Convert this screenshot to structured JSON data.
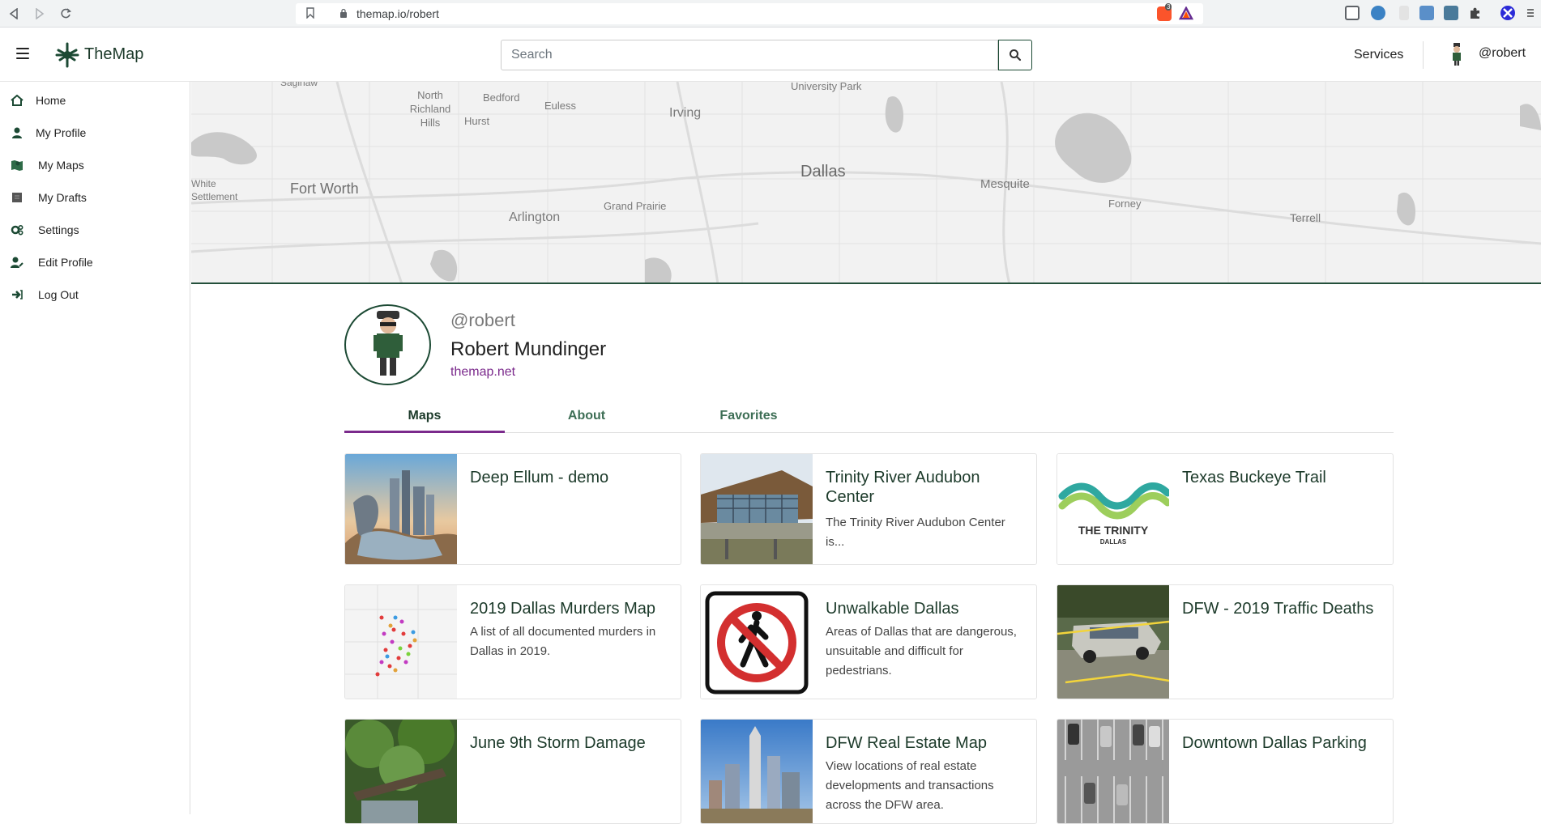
{
  "browser": {
    "url": "themap.io/robert",
    "brave_badge": "3"
  },
  "header": {
    "logo_text": "TheMap",
    "search_placeholder": "Search",
    "services_label": "Services",
    "username": "@robert"
  },
  "sidebar": {
    "items": [
      {
        "label": "Home",
        "icon": "home-icon"
      },
      {
        "label": "My Profile",
        "icon": "user-icon"
      },
      {
        "label": "My Maps",
        "icon": "map-icon"
      },
      {
        "label": "My Drafts",
        "icon": "drafts-icon"
      },
      {
        "label": "Settings",
        "icon": "gears-icon"
      },
      {
        "label": "Edit Profile",
        "icon": "user-edit-icon"
      },
      {
        "label": "Log Out",
        "icon": "logout-icon"
      }
    ]
  },
  "map_banner": {
    "labels": [
      "Saginaw",
      "North Richland Hills",
      "Bedford",
      "Euless",
      "Hurst",
      "Irving",
      "University Park",
      "Dallas",
      "Fort Worth",
      "White Settlement",
      "Arlington",
      "Grand Prairie",
      "Mesquite",
      "Forney",
      "Terrell"
    ]
  },
  "profile": {
    "handle": "@robert",
    "name": "Robert Mundinger",
    "website": "themap.net"
  },
  "tabs": [
    {
      "label": "Maps",
      "active": true
    },
    {
      "label": "About",
      "active": false
    },
    {
      "label": "Favorites",
      "active": false
    }
  ],
  "cards": [
    {
      "title": "Deep Ellum - demo",
      "description": ""
    },
    {
      "title": "Trinity River Audubon Center",
      "description": "The Trinity River Audubon Center is..."
    },
    {
      "title": "Texas Buckeye Trail",
      "description": "",
      "thumb_text": "THE TRINITY",
      "thumb_subtext": "DALLAS"
    },
    {
      "title": "2019 Dallas Murders Map",
      "description": "A list of all documented murders in Dallas in 2019."
    },
    {
      "title": "Unwalkable Dallas",
      "description": "Areas of Dallas that are dangerous, unsuitable and difficult for pedestrians."
    },
    {
      "title": "DFW - 2019 Traffic Deaths",
      "description": ""
    },
    {
      "title": "June 9th Storm Damage",
      "description": ""
    },
    {
      "title": "DFW Real Estate Map",
      "description": "View locations of real estate developments and transactions across the DFW area."
    },
    {
      "title": "Downtown Dallas Parking",
      "description": ""
    }
  ],
  "colors": {
    "brand_green": "#1c4a34",
    "accent_purple": "#7b2a8c"
  }
}
